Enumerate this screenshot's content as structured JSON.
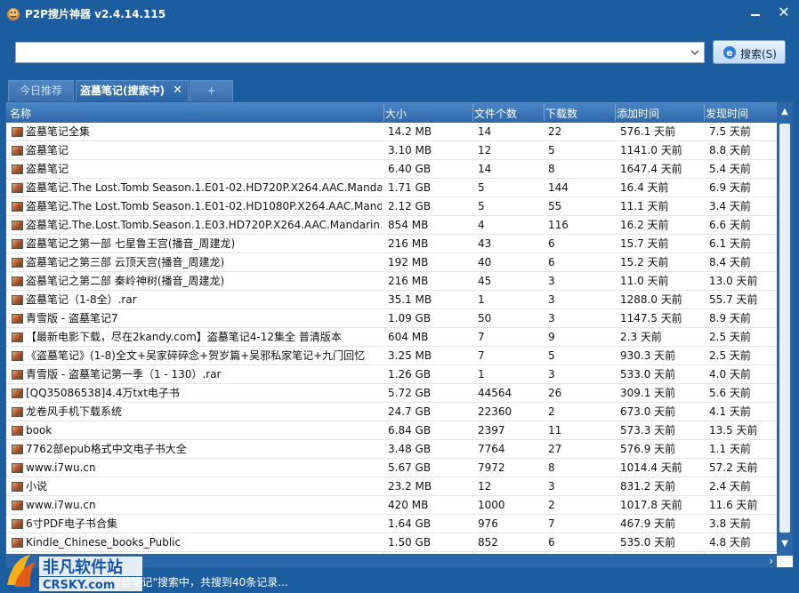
{
  "window": {
    "title": "P2P搜片神器 v2.4.14.115"
  },
  "search": {
    "value": "",
    "placeholder": "",
    "button_label": "搜索(S)"
  },
  "tabs": [
    {
      "label": "今日推荐"
    },
    {
      "label": "盗墓笔记(搜索中)",
      "close": "✕"
    },
    {
      "label": "+"
    }
  ],
  "columns": [
    "名称",
    "大小",
    "文件个数",
    "下载数",
    "添加时间",
    "发现时间"
  ],
  "rows": [
    {
      "name": "盗墓笔记全集",
      "size": "14.2 MB",
      "files": "14",
      "downloads": "22",
      "added": "576.1 天前",
      "found": "7.5 天前"
    },
    {
      "name": "盗墓笔记",
      "size": "3.10 MB",
      "files": "12",
      "downloads": "5",
      "added": "1141.0 天前",
      "found": "8.8 天前"
    },
    {
      "name": "盗墓笔记",
      "size": "6.40 GB",
      "files": "14",
      "downloads": "8",
      "added": "1647.4 天前",
      "found": "5.4 天前"
    },
    {
      "name": "盗墓笔记.The Lost.Tomb Season.1.E01-02.HD720P.X264.AAC.Manda…",
      "size": "1.71 GB",
      "files": "5",
      "downloads": "144",
      "added": "16.4 天前",
      "found": "6.9 天前"
    },
    {
      "name": "盗墓笔记.The Lost.Tomb Season.1.E01-02.HD1080P.X264.AAC.Mand…",
      "size": "2.12 GB",
      "files": "5",
      "downloads": "55",
      "added": "11.1 天前",
      "found": "3.4 天前"
    },
    {
      "name": "盗墓笔记.The.Lost.Tomb.Season.1.E03.HD720P.X264.AAC.Mandarin…",
      "size": "854 MB",
      "files": "4",
      "downloads": "116",
      "added": "16.2 天前",
      "found": "6.6 天前"
    },
    {
      "name": "盗墓笔记之第一部 七星鲁王宫(播音_周建龙)",
      "size": "216 MB",
      "files": "43",
      "downloads": "6",
      "added": "15.7 天前",
      "found": "6.1 天前"
    },
    {
      "name": "盗墓笔记之第三部 云顶天宫(播音_周建龙)",
      "size": "192 MB",
      "files": "40",
      "downloads": "6",
      "added": "15.2 天前",
      "found": "8.4 天前"
    },
    {
      "name": "盗墓笔记之第二部 秦岭神树(播音_周建龙)",
      "size": "216 MB",
      "files": "45",
      "downloads": "3",
      "added": "11.0 天前",
      "found": "13.0 天前"
    },
    {
      "name": "盗墓笔记（1-8全）.rar",
      "size": "35.1 MB",
      "files": "1",
      "downloads": "3",
      "added": "1288.0 天前",
      "found": "55.7 天前"
    },
    {
      "name": "青雪版 - 盗墓笔记7",
      "size": "1.09 GB",
      "files": "50",
      "downloads": "3",
      "added": "1147.5 天前",
      "found": "8.9 天前"
    },
    {
      "name": "【最新电影下载，尽在2kandy.com】盗墓笔记4-12集全 普清版本",
      "size": "604 MB",
      "files": "7",
      "downloads": "9",
      "added": "2.3 天前",
      "found": "2.5 天前"
    },
    {
      "name": "《盗墓笔记》(1-8)全文+吴家碎碎念+贺岁篇+吴邪私家笔记+九门回忆",
      "size": "3.25 MB",
      "files": "7",
      "downloads": "5",
      "added": "930.3 天前",
      "found": "2.5 天前"
    },
    {
      "name": "青雪版 - 盗墓笔记第一季（1 - 130）.rar",
      "size": "1.26 GB",
      "files": "1",
      "downloads": "3",
      "added": "533.0 天前",
      "found": "4.0 天前"
    },
    {
      "name": "[QQ35086538]4.4万txt电子书",
      "size": "5.72 GB",
      "files": "44564",
      "downloads": "26",
      "added": "309.1 天前",
      "found": "5.6 天前"
    },
    {
      "name": "龙卷风手机下载系统",
      "size": "24.7 GB",
      "files": "22360",
      "downloads": "2",
      "added": "673.0 天前",
      "found": "4.1 天前"
    },
    {
      "name": "book",
      "size": "6.84 GB",
      "files": "2397",
      "downloads": "11",
      "added": "573.3 天前",
      "found": "13.5 天前"
    },
    {
      "name": "7762部epub格式中文电子书大全",
      "size": "3.48 GB",
      "files": "7764",
      "downloads": "27",
      "added": "576.9 天前",
      "found": "1.1 天前"
    },
    {
      "name": "www.i7wu.cn",
      "size": "5.67 GB",
      "files": "7972",
      "downloads": "8",
      "added": "1014.4 天前",
      "found": "57.2 天前"
    },
    {
      "name": "小说",
      "size": "23.2 MB",
      "files": "12",
      "downloads": "3",
      "added": "831.2 天前",
      "found": "2.4 天前"
    },
    {
      "name": "www.i7wu.cn",
      "size": "420 MB",
      "files": "1000",
      "downloads": "2",
      "added": "1017.8 天前",
      "found": "11.6 天前"
    },
    {
      "name": "6寸PDF电子书合集",
      "size": "1.64 GB",
      "files": "976",
      "downloads": "7",
      "added": "467.9 天前",
      "found": "3.8 天前"
    },
    {
      "name": "Kindle_Chinese_books_Public",
      "size": "1.50 GB",
      "files": "852",
      "downloads": "6",
      "added": "535.0 天前",
      "found": "4.8 天前"
    }
  ],
  "status": {
    "text": "\"盗墓笔记\"搜索中，共搜到40条记录..."
  },
  "watermark": {
    "line1": "非凡软件站",
    "line2": "CRSKY.com"
  },
  "colors": {
    "chrome": "#1b5d9e",
    "header": "#3a74b6",
    "accent": "#2a68aa"
  }
}
